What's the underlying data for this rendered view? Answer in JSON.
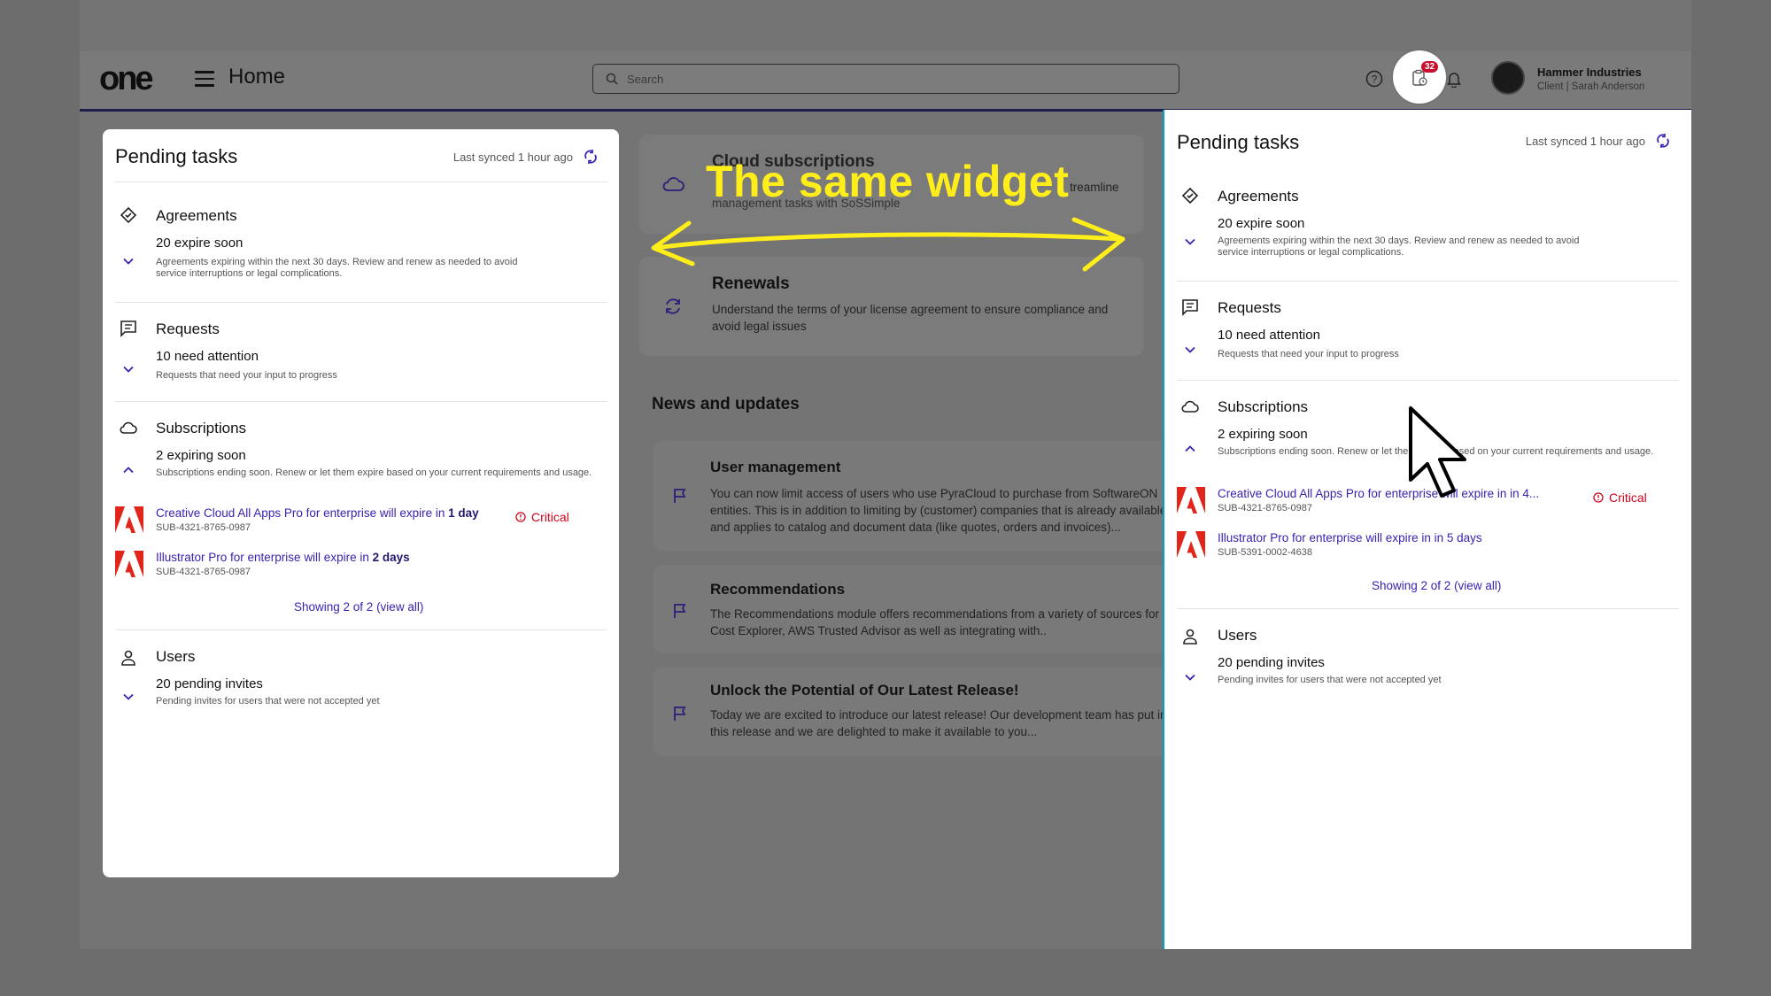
{
  "topbar": {
    "logo": "one",
    "title": "Home",
    "search_placeholder": "Search",
    "tasks_badge": "32",
    "company": "Hammer Industries",
    "client": "Client | Sarah Anderson"
  },
  "middle": {
    "cloud_title": "Cloud subscriptions",
    "cloud_text_right": "treamline",
    "cloud_text": "management tasks with SoSSimple",
    "renewals_title": "Renewals",
    "renewals_text": "Understand the terms of your license agreement to ensure compliance and avoid legal issues",
    "news_heading": "News and updates",
    "news": [
      {
        "title": "User management",
        "text": "You can now limit access of users who use PyraCloud to purchase from SoftwareON entities. This is in addition to limiting by (customer) companies that is already available and applies to catalog and document data (like quotes, orders and invoices)..."
      },
      {
        "title": "Recommendations",
        "text": "The Recommendations module offers recommendations from a variety of sources for Cost Explorer, AWS Trusted Advisor as well as integrating with.."
      },
      {
        "title": "Unlock the Potential of Our Latest Release!",
        "text": "Today we are excited to introduce our latest release! Our development team has put into this release and we are delighted to make it available to you..."
      }
    ]
  },
  "left_widget": {
    "title": "Pending tasks",
    "sync": "Last synced 1 hour ago",
    "agreements": {
      "title": "Agreements",
      "sub": "20 expire soon",
      "desc": "Agreements expiring within the next 30 days. Review and renew as needed to avoid service interruptions or legal complications."
    },
    "requests": {
      "title": "Requests",
      "sub": "10 need attention",
      "desc": "Requests that need your input to progress"
    },
    "subscriptions": {
      "title": "Subscriptions",
      "sub": "2 expiring soon",
      "desc": "Subscriptions ending soon. Renew or let them expire based on your current requirements and usage.",
      "items": [
        {
          "text": "Creative Cloud All Apps Pro for enterprise will expire in ",
          "bold": "1 day",
          "id": "SUB-4321-8765-0987",
          "status": "Critical"
        },
        {
          "text": "Illustrator Pro for enterprise will expire in ",
          "bold": "2 days",
          "id": "SUB-4321-8765-0987",
          "status": ""
        }
      ],
      "view_all": "Showing 2 of 2 (view all)"
    },
    "users": {
      "title": "Users",
      "sub": "20 pending invites",
      "desc": "Pending invites for users that were not accepted yet"
    }
  },
  "right_widget": {
    "title": "Pending tasks",
    "sync": "Last synced 1 hour ago",
    "agreements": {
      "title": "Agreements",
      "sub": "20 expire soon",
      "desc": "Agreements expiring within the next 30 days. Review and renew as needed to avoid service interruptions or legal complications."
    },
    "requests": {
      "title": "Requests",
      "sub": "10 need attention",
      "desc": "Requests that need your input to progress"
    },
    "subscriptions": {
      "title": "Subscriptions",
      "sub": "2 expiring soon",
      "desc": "Subscriptions ending soon. Renew or let them expire based on your current requirements and usage.",
      "items": [
        {
          "text": "Creative Cloud All Apps Pro for enterprise will expire in in 4...",
          "bold": "",
          "id": "SUB-4321-8765-0987",
          "status": "Critical"
        },
        {
          "text": "Illustrator Pro for enterprise will expire in in 5 days",
          "bold": "",
          "id": "SUB-5391-0002-4638",
          "status": ""
        }
      ],
      "view_all": "Showing 2 of 2 (view all)"
    },
    "users": {
      "title": "Users",
      "sub": "20 pending invites",
      "desc": "Pending invites for users that were not accepted yet"
    }
  },
  "annotation": {
    "text": "The same widget"
  },
  "colors": {
    "accent": "#3a1fb0",
    "critical": "#d0021b",
    "annotation": "#ffee1a",
    "panel_border": "#00a3c4"
  }
}
